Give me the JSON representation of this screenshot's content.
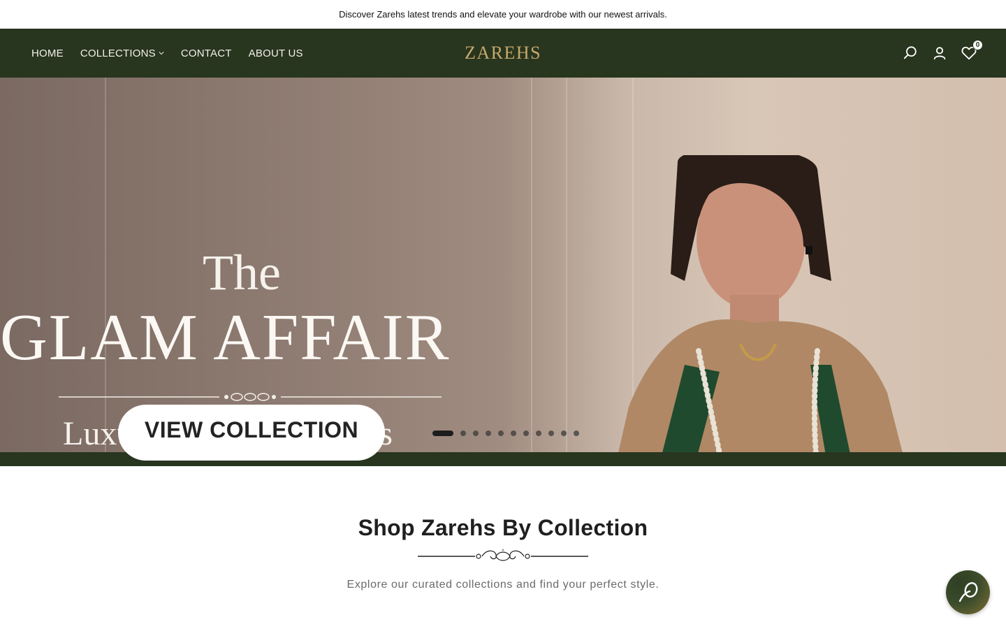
{
  "announcement": {
    "text": "Discover Zarehs latest trends and elevate your wardrobe with our newest arrivals."
  },
  "header": {
    "logo_text": "ZAREHS",
    "nav": [
      {
        "label": "HOME"
      },
      {
        "label": "COLLECTIONS",
        "has_dropdown": true
      },
      {
        "label": "CONTACT"
      },
      {
        "label": "ABOUT US"
      }
    ],
    "icons": [
      "search-icon",
      "account-icon",
      "wishlist-heart-icon"
    ],
    "wishlist_count": "0"
  },
  "hero": {
    "line1": "The",
    "title": "GLAM AFFAIR",
    "subtitle": "Luxury Heirloom Pieces",
    "cta_label": "VIEW COLLECTION",
    "slide_count": 11,
    "active_slide": 1
  },
  "collections_section": {
    "title": "Shop Zarehs By Collection",
    "subtitle": "Explore our curated collections and find your perfect style."
  },
  "colors": {
    "header_bg": "#28351f",
    "logo_gold": "#c7a86a",
    "nav_text": "#f3f1ea"
  }
}
